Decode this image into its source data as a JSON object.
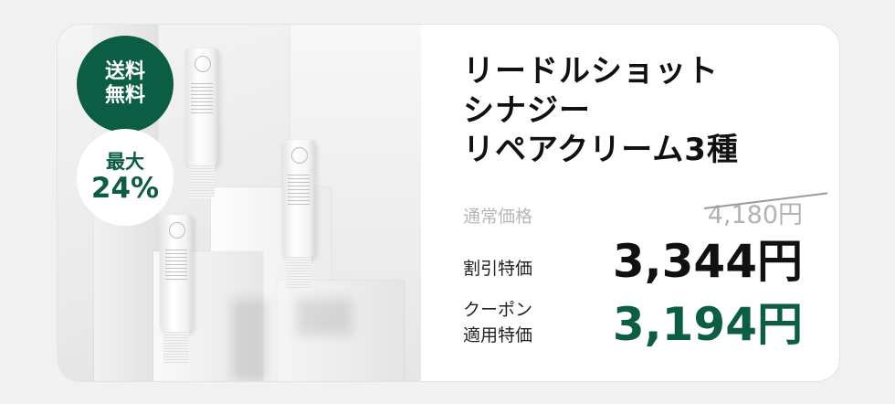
{
  "badges": {
    "free_shipping": [
      "送料",
      "無料"
    ],
    "discount_line1": "最大",
    "discount_line2": "24%"
  },
  "product": {
    "title_lines": [
      "リードルショット",
      "シナジー",
      "リペアクリーム3種"
    ]
  },
  "pricing": {
    "regular_label": "通常価格",
    "regular_price": "4,180円",
    "sale_label": "割引特価",
    "sale_price": "3,344円",
    "coupon_label_lines": [
      "クーポン",
      "適用特価"
    ],
    "coupon_price": "3,194円"
  },
  "colors": {
    "brand_green": "#0b5e43",
    "strike_gray": "#b3b3b3"
  }
}
